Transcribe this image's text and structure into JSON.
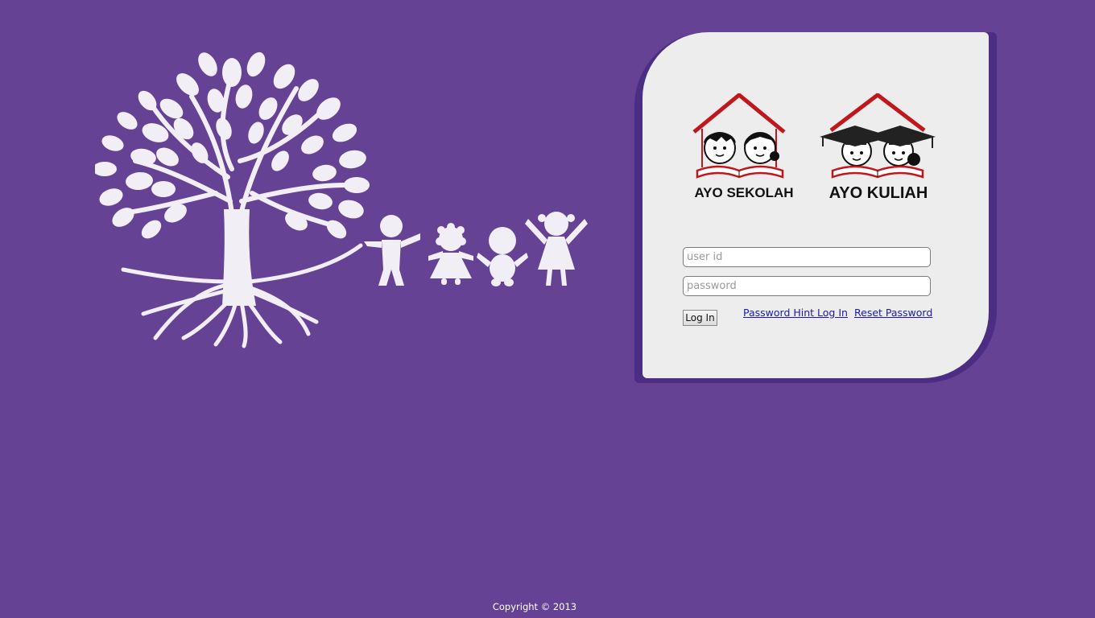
{
  "brand": {
    "logo_left_text": "AYO SEKOLAH",
    "logo_right_text": "AYO KULIAH"
  },
  "login": {
    "userid_placeholder": "user id",
    "password_placeholder": "password",
    "login_label": "Log In",
    "hint_link": "Password Hint Log In",
    "reset_link": "Reset Password"
  },
  "footer": {
    "copyright": "Copyright © 2013"
  },
  "colors": {
    "background": "#654294",
    "panel": "#ededed",
    "panel_shadow": "#4b2d83",
    "roof_red": "#c0161c",
    "illustration": "#f2eef5",
    "link": "#1a1aa6"
  },
  "icons": {
    "illustration": "tree-with-children-icon",
    "logo_left": "school-kids-under-roof-icon",
    "logo_right": "graduates-under-roof-icon"
  }
}
